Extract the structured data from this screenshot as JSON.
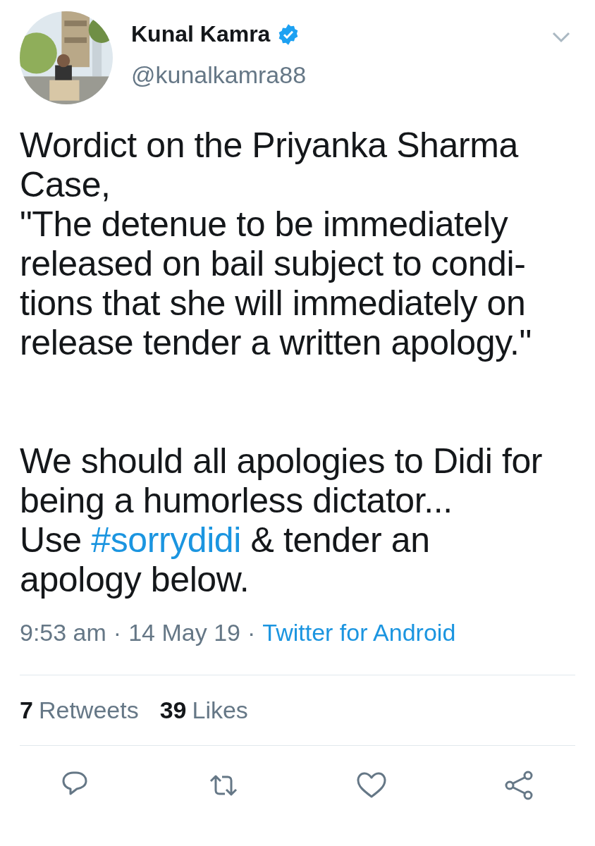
{
  "author": {
    "name": "Kunal Kamra",
    "verified": true,
    "handle": "@kunalkamra88"
  },
  "tweet": {
    "paragraphs": [
      {
        "lines": [
          [
            {
              "kind": "text",
              "text": "Wordict on the Priyanka Sharma"
            }
          ],
          [
            {
              "kind": "text",
              "text": "Case,"
            }
          ],
          [
            {
              "kind": "text",
              "text": "\"The detenue to be immediately"
            }
          ],
          [
            {
              "kind": "text",
              "text": "released on bail subject to condi-"
            }
          ],
          [
            {
              "kind": "text",
              "text": "tions that she will immediately on"
            }
          ],
          [
            {
              "kind": "text",
              "text": "release tender a written apology.\""
            }
          ]
        ]
      },
      {
        "lines": [
          [
            {
              "kind": "text",
              "text": "We should all apologies to Didi for"
            }
          ],
          [
            {
              "kind": "text",
              "text": "being a humorless dictator..."
            }
          ],
          [
            {
              "kind": "text",
              "text": "Use "
            },
            {
              "kind": "hashtag",
              "text": "#sorrydidi"
            },
            {
              "kind": "text",
              "text": " & tender an"
            }
          ],
          [
            {
              "kind": "text",
              "text": "apology below."
            }
          ]
        ]
      }
    ]
  },
  "meta": {
    "time": "9:53 am",
    "separator_1": "·",
    "date": "14 May 19",
    "separator_2": "·",
    "source": "Twitter for Android"
  },
  "stats": [
    {
      "count": "7",
      "label": "Retweets"
    },
    {
      "count": "39",
      "label": "Likes"
    }
  ],
  "actions": [
    {
      "kind": "reply"
    },
    {
      "kind": "retweet"
    },
    {
      "kind": "like"
    },
    {
      "kind": "share"
    }
  ]
}
